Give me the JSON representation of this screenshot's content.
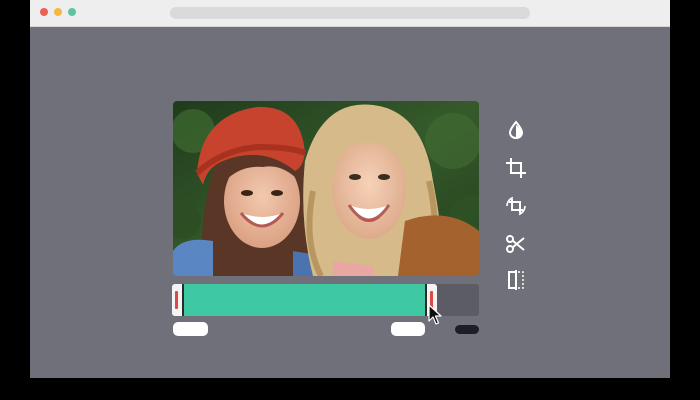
{
  "window": {
    "controls": [
      "close-dot",
      "minimize-dot",
      "maximize-dot"
    ],
    "address_bar": ""
  },
  "colors": {
    "canvas": "#6f7079",
    "trim_selection": "#3ec9a3",
    "handle": "#f4f4f4",
    "handle_grip": "#e04848",
    "track": "#5b5c64"
  },
  "tools": [
    {
      "icon": "color-drop-icon",
      "name": "color-adjust"
    },
    {
      "icon": "crop-icon",
      "name": "crop"
    },
    {
      "icon": "rotate-crop-icon",
      "name": "rotate"
    },
    {
      "icon": "scissors-icon",
      "name": "cut"
    },
    {
      "icon": "split-icon",
      "name": "split"
    }
  ],
  "timeline": {
    "selection_start_fraction": 0.03,
    "selection_end_fraction": 0.83,
    "start_label": "",
    "end_label": "",
    "duration_label": ""
  },
  "cursor": {
    "icon": "arrow-cursor-icon"
  }
}
